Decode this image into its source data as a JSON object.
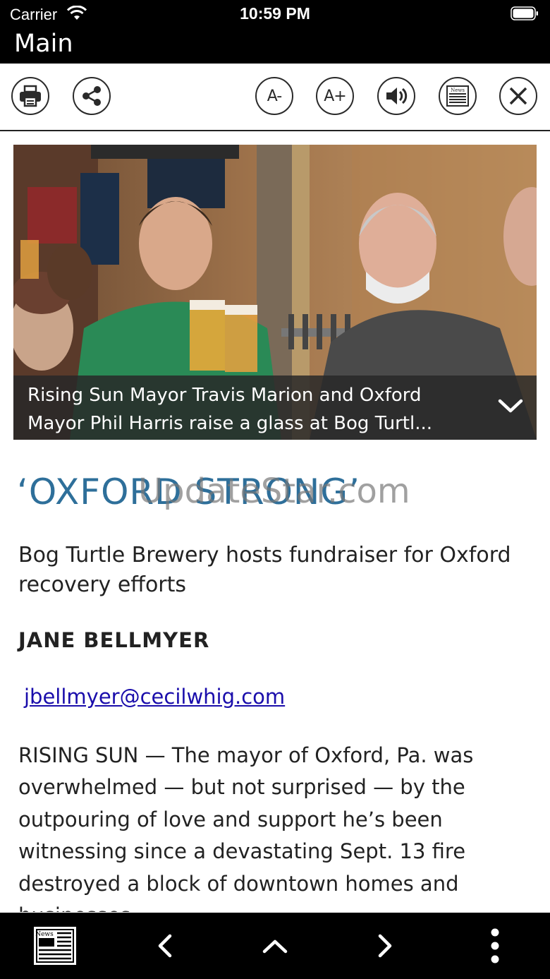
{
  "status_bar": {
    "carrier": "Carrier",
    "time": "10:59 PM"
  },
  "nav": {
    "title": "Main"
  },
  "toolbar": {
    "print_icon": "print-icon",
    "share_icon": "share-icon",
    "font_decrease_label": "A-",
    "font_increase_label": "A+",
    "speaker_icon": "speaker-icon",
    "newspaper_icon": "newspaper-icon",
    "newspaper_label": "News",
    "close_icon": "close-icon"
  },
  "photo": {
    "caption": "Rising Sun Mayor Travis Marion and Oxford Mayor Phil Harris raise a glass at Bog Turtl..."
  },
  "article": {
    "headline": "‘OXFORD STRONG’",
    "watermark": "UpdateStar.com",
    "subhead": "Bog Turtle Brewery hosts fundraiser for Oxford recovery efforts",
    "author": "JANE BELLMYER",
    "email": "jbellmyer@cecilwhig.com",
    "body": "RISING SUN — The mayor of Oxford, Pa. was overwhelmed — but not surprised — by the outpouring of love and support he’s been witnessing since a devastating Sept. 13 fire destroyed a block of downtown homes and businesses."
  },
  "bottom_bar": {
    "newspaper_label": "News",
    "items": [
      "newspaper-icon",
      "chevron-left-icon",
      "chevron-up-icon",
      "chevron-right-icon",
      "more-vertical-icon"
    ]
  },
  "colors": {
    "headline": "#2e6f9a",
    "link": "#1a0dab",
    "bars": "#000000"
  }
}
